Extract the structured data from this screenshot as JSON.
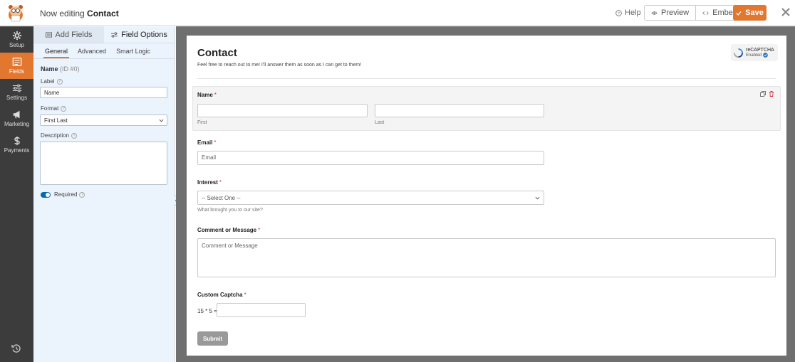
{
  "topbar": {
    "editing_prefix": "Now editing",
    "form_name": "Contact",
    "help_label": "Help",
    "preview_label": "Preview",
    "embed_label": "Embed",
    "save_label": "Save",
    "accent_color": "#e27730"
  },
  "sidebar": {
    "items": [
      {
        "label": "Setup",
        "icon": "gear-icon"
      },
      {
        "label": "Fields",
        "icon": "fields-icon"
      },
      {
        "label": "Settings",
        "icon": "sliders-icon"
      },
      {
        "label": "Marketing",
        "icon": "megaphone-icon"
      },
      {
        "label": "Payments",
        "icon": "dollar-icon"
      }
    ],
    "active": "Fields"
  },
  "panel": {
    "tabs": [
      {
        "label": "Add Fields"
      },
      {
        "label": "Field Options"
      }
    ],
    "active_tab": "Field Options",
    "subtabs": [
      {
        "label": "General"
      },
      {
        "label": "Advanced"
      },
      {
        "label": "Smart Logic"
      }
    ],
    "active_subtab": "General",
    "field_name": "Name",
    "field_id": "(ID #0)",
    "label_caption": "Label",
    "label_value": "Name",
    "format_caption": "Format",
    "format_value": "First Last",
    "description_caption": "Description",
    "required_label": "Required",
    "required_on": true
  },
  "form": {
    "title": "Contact",
    "description": "Feel free to reach out to me! I'll answer them as soon as I can get to them!",
    "recaptcha": {
      "title": "reCAPTCHA",
      "status": "Enabled"
    },
    "required_marker": "*",
    "name_field": {
      "label": "Name",
      "first_sublabel": "First",
      "last_sublabel": "Last"
    },
    "email_field": {
      "label": "Email",
      "placeholder": "Email"
    },
    "interest_field": {
      "label": "Interest",
      "selected": "-- Select One --",
      "help": "What brought you to our site?"
    },
    "comment_field": {
      "label": "Comment or Message",
      "placeholder": "Comment or Message"
    },
    "captcha_field": {
      "label": "Custom Captcha",
      "question": "15 * 5 ="
    },
    "submit_label": "Submit"
  }
}
